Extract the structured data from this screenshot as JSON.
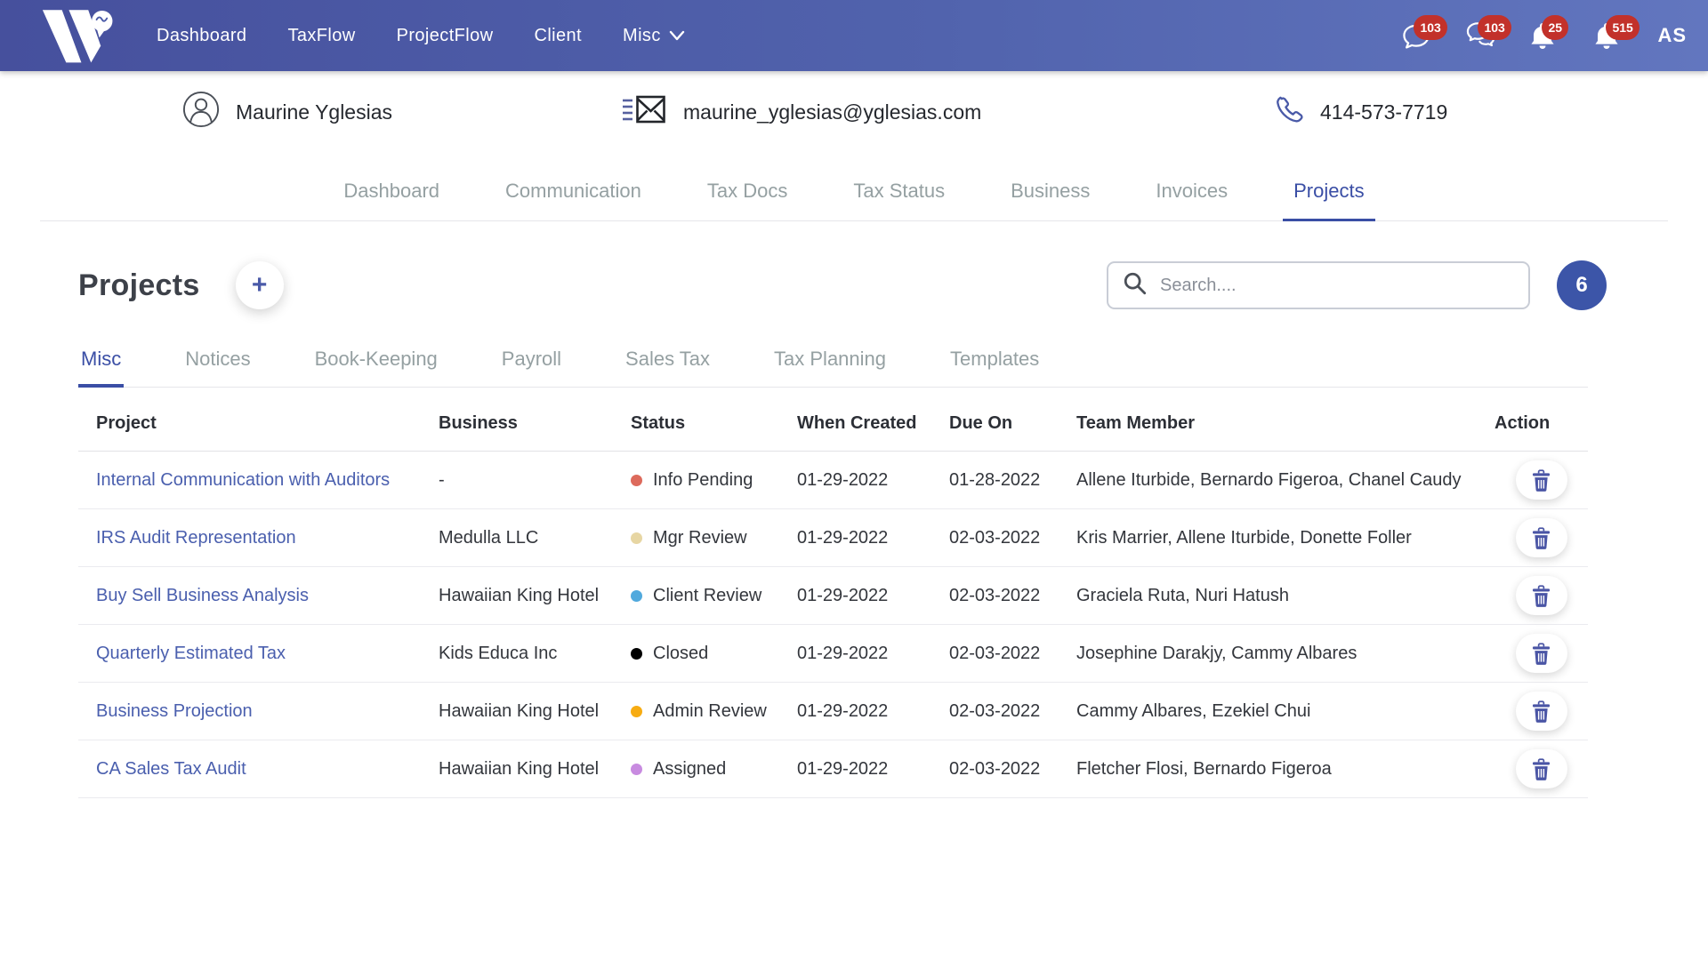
{
  "navbar": {
    "brand_name": "W",
    "items": [
      {
        "label": "Dashboard"
      },
      {
        "label": "TaxFlow"
      },
      {
        "label": "ProjectFlow"
      },
      {
        "label": "Client"
      },
      {
        "label": "Misc",
        "dropdown": true
      }
    ],
    "notifications": [
      {
        "icon": "chat-icon",
        "count": "103"
      },
      {
        "icon": "chats-icon",
        "count": "103"
      },
      {
        "icon": "bell-icon",
        "count": "25"
      },
      {
        "icon": "bell-icon",
        "count": "515"
      }
    ],
    "avatar_initials": "AS"
  },
  "client_header": {
    "name": "Maurine Yglesias",
    "email": "maurine_yglesias@yglesias.com",
    "phone": "414-573-7719"
  },
  "tabs": {
    "items": [
      "Dashboard",
      "Communication",
      "Tax Docs",
      "Tax Status",
      "Business",
      "Invoices",
      "Projects"
    ],
    "active": "Projects"
  },
  "projects": {
    "title": "Projects",
    "add_label": "+",
    "search_placeholder": "Search....",
    "count_badge": "6",
    "subtabs": {
      "items": [
        "Misc",
        "Notices",
        "Book-Keeping",
        "Payroll",
        "Sales Tax",
        "Tax Planning",
        "Templates"
      ],
      "active": "Misc"
    }
  },
  "table": {
    "columns": [
      "Project",
      "Business",
      "Status",
      "When Created",
      "Due On",
      "Team Member",
      "Action"
    ],
    "rows": [
      {
        "project": "Internal Communication with Auditors",
        "business": "-",
        "status": "Info Pending",
        "status_color": "#dd6a5c",
        "when_created": "01-29-2022",
        "due_on": "01-28-2022",
        "team_member": "Allene Iturbide, Bernardo Figeroa, Chanel Caudy"
      },
      {
        "project": "IRS Audit Representation",
        "business": "Medulla LLC",
        "status": "Mgr Review",
        "status_color": "#e7d6a3",
        "when_created": "01-29-2022",
        "due_on": "02-03-2022",
        "team_member": "Kris Marrier, Allene Iturbide, Donette Foller"
      },
      {
        "project": "Buy Sell Business Analysis",
        "business": "Hawaiian King Hotel",
        "status": "Client Review",
        "status_color": "#51a9dd",
        "when_created": "01-29-2022",
        "due_on": "02-03-2022",
        "team_member": "Graciela Ruta, Nuri Hatush"
      },
      {
        "project": "Quarterly Estimated Tax",
        "business": "Kids Educa Inc",
        "status": "Closed",
        "status_color": "#000000",
        "when_created": "01-29-2022",
        "due_on": "02-03-2022",
        "team_member": "Josephine Darakjy, Cammy Albares"
      },
      {
        "project": "Business Projection",
        "business": "Hawaiian King Hotel",
        "status": "Admin Review",
        "status_color": "#f7ac12",
        "when_created": "01-29-2022",
        "due_on": "02-03-2022",
        "team_member": "Cammy Albares, Ezekiel Chui"
      },
      {
        "project": "CA Sales Tax Audit",
        "business": "Hawaiian King Hotel",
        "status": "Assigned",
        "status_color": "#c88be0",
        "when_created": "01-29-2022",
        "due_on": "02-03-2022",
        "team_member": "Fletcher Flosi, Bernardo Figeroa"
      }
    ]
  },
  "colors": {
    "navbar_start": "#46509d",
    "navbar_end": "#6276bf",
    "badge_red": "#c2312a",
    "accent_blue": "#3a4ea5",
    "link_blue": "#4a5fae",
    "count_badge_blue": "#3c55a8",
    "inactive_tab": "#95a0a2"
  }
}
